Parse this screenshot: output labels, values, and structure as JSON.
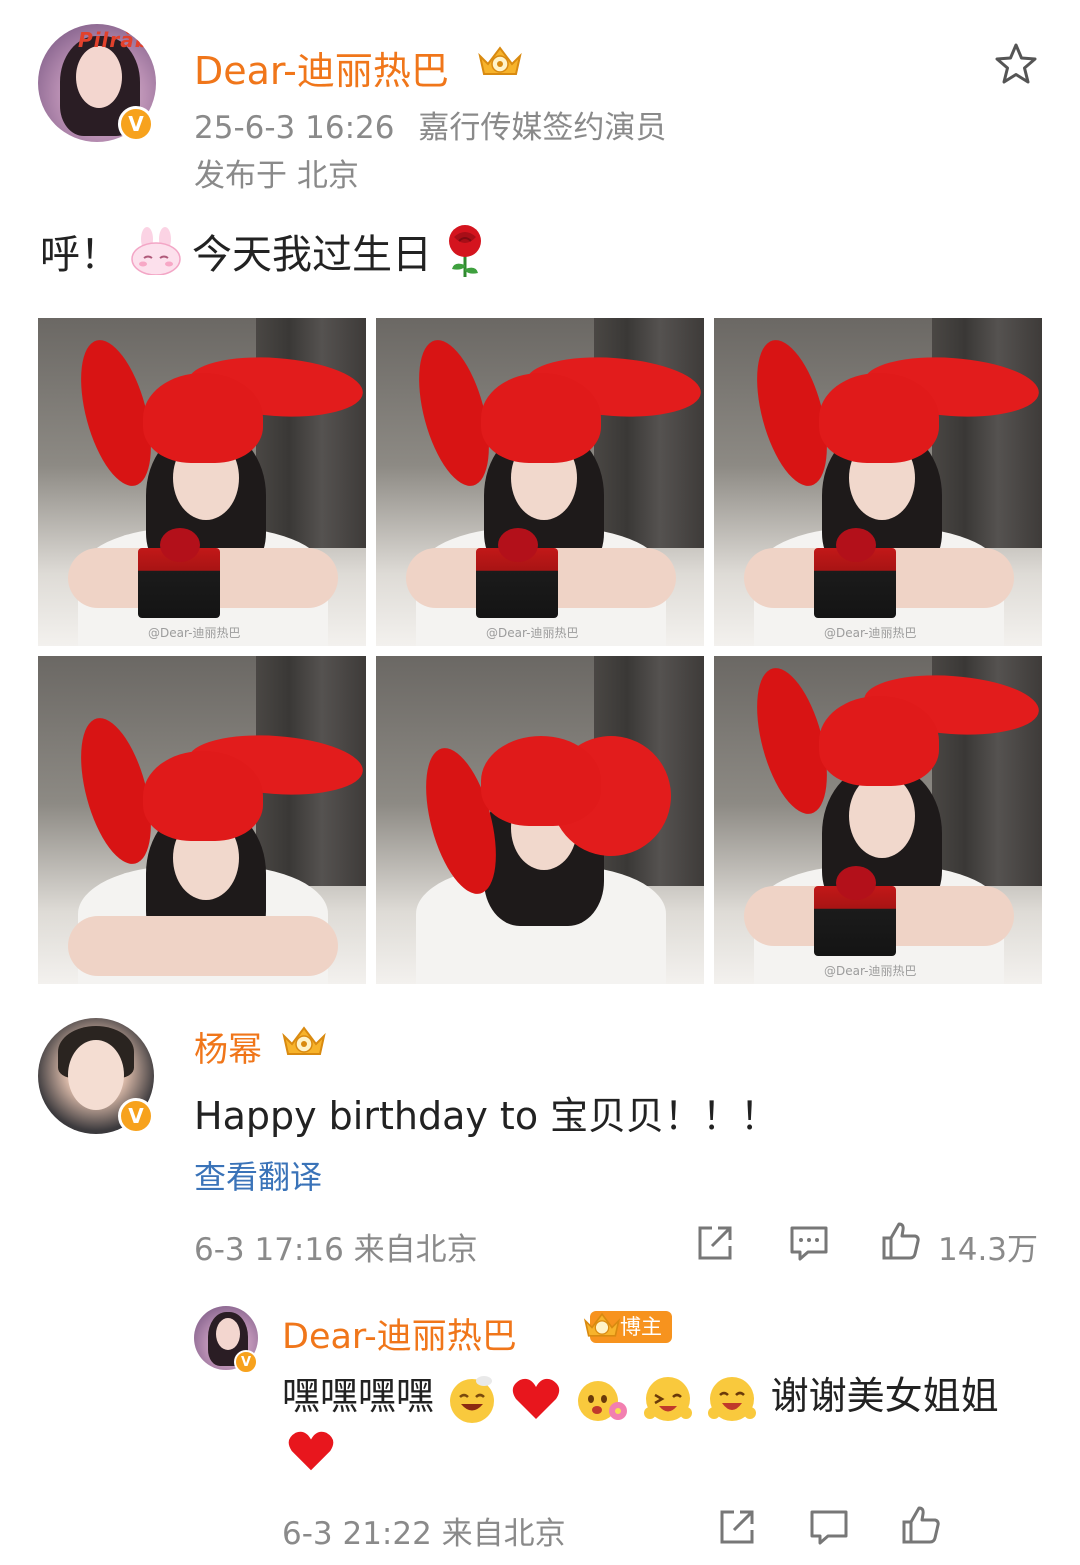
{
  "post": {
    "author_name": "Dear-迪丽热巴",
    "timestamp": "25-6-3 16:26",
    "author_title": "嘉行传媒签约演员",
    "location": "发布于 北京",
    "text_prefix": "呼！",
    "text_main": "今天我过生日",
    "avatar_logo_text": "Pilràba",
    "verified_badge": "V"
  },
  "photos": [
    {
      "watermark": "@Dear-迪丽热巴"
    },
    {
      "watermark": "@Dear-迪丽热巴"
    },
    {
      "watermark": "@Dear-迪丽热巴"
    },
    {
      "watermark": ""
    },
    {
      "watermark": ""
    },
    {
      "watermark": "@Dear-迪丽热巴"
    }
  ],
  "comment": {
    "author_name": "杨幂",
    "text": "Happy birthday to 宝贝贝！！！",
    "translate_label": "查看翻译",
    "meta": "6-3 17:16 来自北京",
    "like_count": "14.3万",
    "verified_badge": "V"
  },
  "reply": {
    "author_name": "Dear-迪丽热巴",
    "blogger_tag": "博主",
    "text_start": "嘿嘿嘿嘿",
    "text_end": "谢谢美女姐姐",
    "meta": "6-3 21:22 来自北京"
  },
  "colors": {
    "name_orange": "#f0761a",
    "meta_gray": "#8a8a8a",
    "link_blue": "#3a73b8",
    "badge_yellow": "#f7a21d"
  },
  "icons": [
    "star-icon",
    "crown-badge-icon",
    "verified-icon",
    "share-icon",
    "comment-icon",
    "like-icon",
    "heart-icon",
    "bunny-emoji-icon",
    "rose-emoji-icon"
  ]
}
